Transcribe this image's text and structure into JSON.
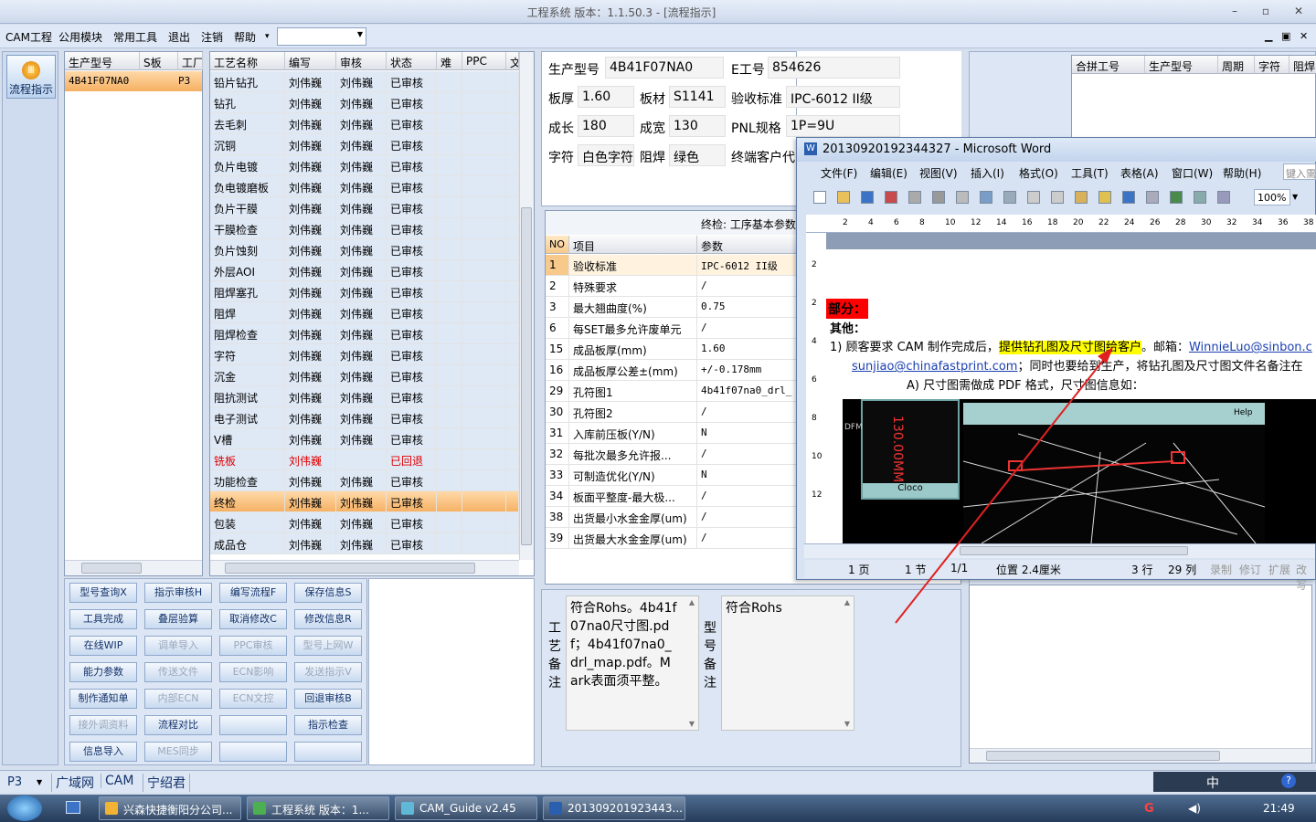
{
  "window": {
    "title": "工程系统   版本：1.1.50.3 - [流程指示]",
    "min": "–",
    "max": "▫",
    "close": "✕"
  },
  "menu": {
    "items": [
      "CAM工程",
      "公用模块",
      "常用工具",
      "退出",
      "注销",
      "帮助"
    ],
    "help_arrow": "▾",
    "combo_value": ""
  },
  "mdi": {
    "min": "▁",
    "restore": "▣",
    "close": "✕"
  },
  "sidebar": {
    "flow_label": "流程指示"
  },
  "model_list": {
    "headers": [
      "生产型号",
      "S板",
      "工厂"
    ],
    "rows": [
      {
        "model": "4B41F07NA0",
        "plant": "P3"
      }
    ]
  },
  "process": {
    "headers": [
      "工艺名称",
      "编写",
      "审核",
      "状态",
      "难",
      "PPC",
      "文"
    ],
    "rows": [
      {
        "name": "铅片钻孔",
        "writer": "刘伟巍",
        "reviewer": "刘伟巍",
        "status": "已审核"
      },
      {
        "name": "钻孔",
        "writer": "刘伟巍",
        "reviewer": "刘伟巍",
        "status": "已审核"
      },
      {
        "name": "去毛刺",
        "writer": "刘伟巍",
        "reviewer": "刘伟巍",
        "status": "已审核"
      },
      {
        "name": "沉铜",
        "writer": "刘伟巍",
        "reviewer": "刘伟巍",
        "status": "已审核"
      },
      {
        "name": "负片电镀",
        "writer": "刘伟巍",
        "reviewer": "刘伟巍",
        "status": "已审核"
      },
      {
        "name": "负电镀磨板",
        "writer": "刘伟巍",
        "reviewer": "刘伟巍",
        "status": "已审核"
      },
      {
        "name": "负片干膜",
        "writer": "刘伟巍",
        "reviewer": "刘伟巍",
        "status": "已审核"
      },
      {
        "name": "干膜检查",
        "writer": "刘伟巍",
        "reviewer": "刘伟巍",
        "status": "已审核"
      },
      {
        "name": "负片蚀刻",
        "writer": "刘伟巍",
        "reviewer": "刘伟巍",
        "status": "已审核"
      },
      {
        "name": "外层AOI",
        "writer": "刘伟巍",
        "reviewer": "刘伟巍",
        "status": "已审核"
      },
      {
        "name": "阻焊塞孔",
        "writer": "刘伟巍",
        "reviewer": "刘伟巍",
        "status": "已审核"
      },
      {
        "name": "阻焊",
        "writer": "刘伟巍",
        "reviewer": "刘伟巍",
        "status": "已审核"
      },
      {
        "name": "阻焊检查",
        "writer": "刘伟巍",
        "reviewer": "刘伟巍",
        "status": "已审核"
      },
      {
        "name": "字符",
        "writer": "刘伟巍",
        "reviewer": "刘伟巍",
        "status": "已审核"
      },
      {
        "name": "沉金",
        "writer": "刘伟巍",
        "reviewer": "刘伟巍",
        "status": "已审核"
      },
      {
        "name": "阻抗测试",
        "writer": "刘伟巍",
        "reviewer": "刘伟巍",
        "status": "已审核"
      },
      {
        "name": "电子测试",
        "writer": "刘伟巍",
        "reviewer": "刘伟巍",
        "status": "已审核"
      },
      {
        "name": "V槽",
        "writer": "刘伟巍",
        "reviewer": "刘伟巍",
        "status": "已审核"
      },
      {
        "name": "铣板",
        "writer": "刘伟巍",
        "reviewer": "",
        "status": "已回退"
      },
      {
        "name": "功能检查",
        "writer": "刘伟巍",
        "reviewer": "刘伟巍",
        "status": "已审核"
      },
      {
        "name": "终检",
        "writer": "刘伟巍",
        "reviewer": "刘伟巍",
        "status": "已审核"
      },
      {
        "name": "包装",
        "writer": "刘伟巍",
        "reviewer": "刘伟巍",
        "status": "已审核"
      },
      {
        "name": "成品仓",
        "writer": "刘伟巍",
        "reviewer": "刘伟巍",
        "status": "已审核"
      }
    ],
    "selected_index": 20,
    "returned_index": 18
  },
  "buttons": [
    [
      "型号查询X",
      "指示审核H",
      "编写流程F",
      "保存信息S"
    ],
    [
      "工具完成",
      "叠层验算",
      "取消修改C",
      "修改信息R"
    ],
    [
      "在线WIP",
      "调单导入",
      "PPC审核",
      "型号上网W"
    ],
    [
      "能力参数",
      "传送文件",
      "ECN影响",
      "发送指示V"
    ],
    [
      "制作通知单",
      "内部ECN",
      "ECN文控",
      "回退审核B"
    ],
    [
      "接外调资料",
      "流程对比",
      "",
      "指示检查"
    ],
    [
      "信息导入",
      "MES同步",
      "",
      ""
    ]
  ],
  "disabled_buttons": [
    "调单导入",
    "PPC审核",
    "型号上网W",
    "传送文件",
    "ECN影响",
    "发送指示V",
    "内部ECN",
    "ECN文控",
    "接外调资料",
    "MES同步"
  ],
  "info": {
    "model_label": "生产型号",
    "model": "4B41F07NA0",
    "eng_label": "E工号",
    "eng": "854626",
    "thick_label": "板厚",
    "thick": "1.60",
    "mat_label": "板材",
    "mat": "S1141",
    "std_label": "验收标准",
    "std": "IPC-6012 II级",
    "len_label": "成长",
    "len": "180",
    "wid_label": "成宽",
    "wid": "130",
    "pnl_label": "PNL规格",
    "pnl": "1P=9U",
    "char_label": "字符",
    "char": "白色字符",
    "mask_label": "阻焊",
    "mask": "绿色",
    "cust_label": "终端客户代"
  },
  "right_table": {
    "headers": [
      "合拼工号",
      "生产型号",
      "周期",
      "字符",
      "阻焊"
    ]
  },
  "params": {
    "title": "终检: 工序基本参数",
    "headers": [
      "NO",
      "项目",
      "参数"
    ],
    "rows": [
      [
        "1",
        "验收标准",
        "IPC-6012 II级"
      ],
      [
        "2",
        "特殊要求",
        "/"
      ],
      [
        "3",
        "最大翘曲度(%)",
        "0.75"
      ],
      [
        "6",
        "每SET最多允许废单元",
        "/"
      ],
      [
        "15",
        "成品板厚(mm)",
        "1.60"
      ],
      [
        "16",
        "成品板厚公差±(mm)",
        "+/-0.178mm"
      ],
      [
        "29",
        "孔符图1",
        "4b41f07na0_drl_"
      ],
      [
        "30",
        "孔符图2",
        "/"
      ],
      [
        "31",
        "入库前压板(Y/N)",
        "N"
      ],
      [
        "32",
        "每批次最多允许报...",
        "/"
      ],
      [
        "33",
        "可制造优化(Y/N)",
        "N"
      ],
      [
        "34",
        "板面平整度-最大极...",
        "/"
      ],
      [
        "38",
        "出货最小水金金厚(um)",
        "/"
      ],
      [
        "39",
        "出货最大水金金厚(um)",
        "/"
      ]
    ]
  },
  "notes": {
    "proc_label": [
      "工",
      "艺",
      "备",
      "注"
    ],
    "proc_text": "符合Rohs。4b41f07na0尺寸图.pdf；4b41f07na0_drl_map.pdf。Mark表面须平整。",
    "model_label": [
      "型",
      "号",
      "备",
      "注"
    ],
    "model_text": "符合Rohs"
  },
  "word": {
    "title": "20130920192344327 - Microsoft Word",
    "menus": [
      "文件(F)",
      "编辑(E)",
      "视图(V)",
      "插入(I)",
      "格式(O)",
      "工具(T)",
      "表格(A)",
      "窗口(W)",
      "帮助(H)"
    ],
    "search_hint": "键入需",
    "zoom": "100%",
    "ruler": [
      "2",
      "4",
      "6",
      "8",
      "10",
      "12",
      "14",
      "16",
      "18",
      "20",
      "22",
      "24",
      "26",
      "28",
      "30",
      "32",
      "34",
      "36",
      "38",
      "4"
    ],
    "vruler": [
      "2",
      "2",
      "4",
      "6",
      "8",
      "10",
      "12"
    ],
    "heading": "部分：",
    "sub": "其他：",
    "line1_a": "1)  顾客要求 CAM 制作完成后，",
    "line1_hl": "提供钻孔图及尺寸图给客户",
    "line1_b": "。邮箱：",
    "line1_mail": "WinnieLuo@sinbon.c",
    "line2_mail": "sunjiao@chinafastprint.com",
    "line2_b": "；同时也要给到生产，将钻孔图及尺寸图文件名备注在",
    "line3": "A)  尺寸图需做成 PDF 格式，尺寸图信息如：",
    "img_labels": [
      "DFM",
      "Help",
      "Cloco",
      "130.00MM"
    ],
    "status": {
      "page": "1 页",
      "section": "1 节",
      "pages": "1/1",
      "pos": "位置 2.4厘米",
      "line": "3 行",
      "col": "29 列",
      "rec": "录制",
      "rev": "修订",
      "ext": "扩展",
      "ovr": "改写"
    }
  },
  "bottom": {
    "plant": "P3",
    "tabs": [
      "广域网",
      "CAM",
      "宁绍君"
    ]
  },
  "tray": {
    "ime": "中",
    "time": "21:49"
  },
  "taskbar": {
    "items": [
      "兴森快捷衡阳分公司...",
      "工程系统  版本：1...",
      "CAM_Guide v2.45",
      "201309201923443..."
    ]
  },
  "colors": {
    "accent": "#f5b062",
    "returned": "#e00000",
    "highlight": "#ffff00",
    "heading_bg": "#ff0000",
    "arrow": "#e02020"
  }
}
